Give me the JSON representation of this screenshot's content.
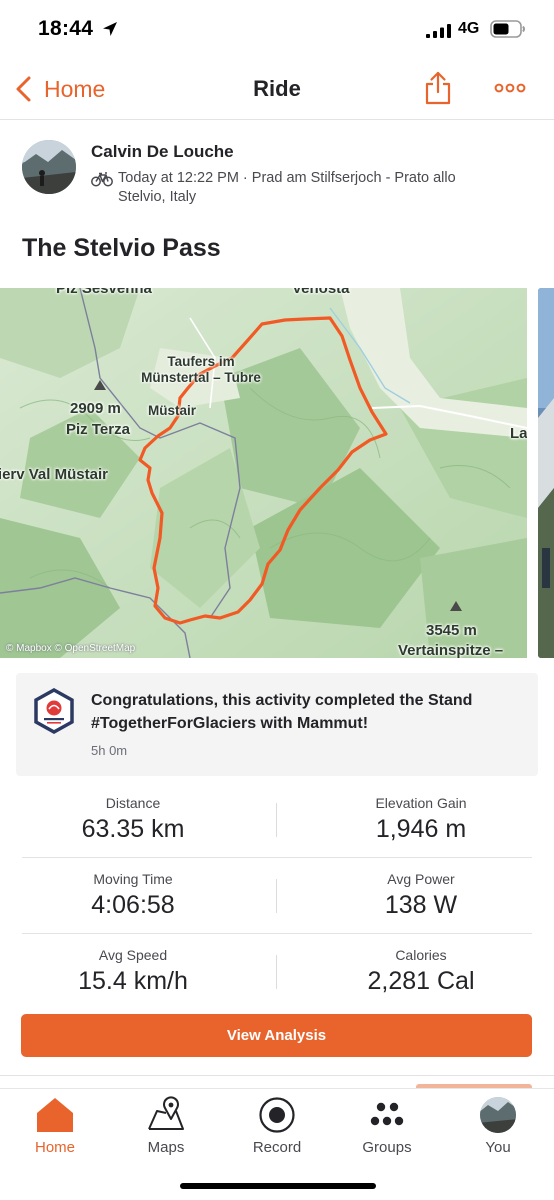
{
  "status_bar": {
    "time": "18:44",
    "network": "4G",
    "icons": [
      "location-arrow-icon",
      "signal-bars-icon",
      "battery-icon"
    ]
  },
  "nav": {
    "back_label": "Home",
    "title": "Ride",
    "icons": [
      "chevron-left-icon",
      "share-icon",
      "more-dots-icon"
    ]
  },
  "athlete": {
    "name": "Calvin De Louche",
    "meta": "Today at 12:22 PM · Prad am Stilfserjoch - Prato allo Stelvio, Italy",
    "activity_icon": "bike-icon"
  },
  "activity": {
    "title": "The Stelvio Pass"
  },
  "map": {
    "labels": {
      "top_town": "Venosta",
      "top_left": "Piz Sesvenna",
      "taufers": "Taufers im Münstertal – Tubre",
      "mustair": "Müstair",
      "peak1_elev": "2909 m",
      "peak1_name": "Piz Terza",
      "valley": "Tschierv Val Müstair",
      "right_edge": "La",
      "peak2_elev": "3545 m",
      "peak2_name": "Vertainspitze –"
    },
    "attribution": "© Mapbox © OpenStreetMap",
    "colors": {
      "route": "#f15a24",
      "terrain": "#cfe3c7"
    }
  },
  "challenge": {
    "text": "Congratulations, this activity completed the Stand #TogetherForGlaciers with Mammut!",
    "duration": "5h 0m",
    "badge_icon": "mammut-badge-icon"
  },
  "stats": [
    {
      "label": "Distance",
      "value": "63.35 km"
    },
    {
      "label": "Elevation Gain",
      "value": "1,946 m"
    },
    {
      "label": "Moving Time",
      "value": "4:06:58"
    },
    {
      "label": "Avg Power",
      "value": "138 W"
    },
    {
      "label": "Avg Speed",
      "value": "15.4 km/h"
    },
    {
      "label": "Calories",
      "value": "2,281 Cal"
    }
  ],
  "analysis_button": "View Analysis",
  "tabs": [
    {
      "label": "Home",
      "icon": "home-icon",
      "active": true
    },
    {
      "label": "Maps",
      "icon": "map-pin-icon",
      "active": false
    },
    {
      "label": "Record",
      "icon": "record-icon",
      "active": false
    },
    {
      "label": "Groups",
      "icon": "groups-icon",
      "active": false
    },
    {
      "label": "You",
      "icon": "profile-avatar",
      "active": false
    }
  ],
  "accent_color": "#e8642c"
}
